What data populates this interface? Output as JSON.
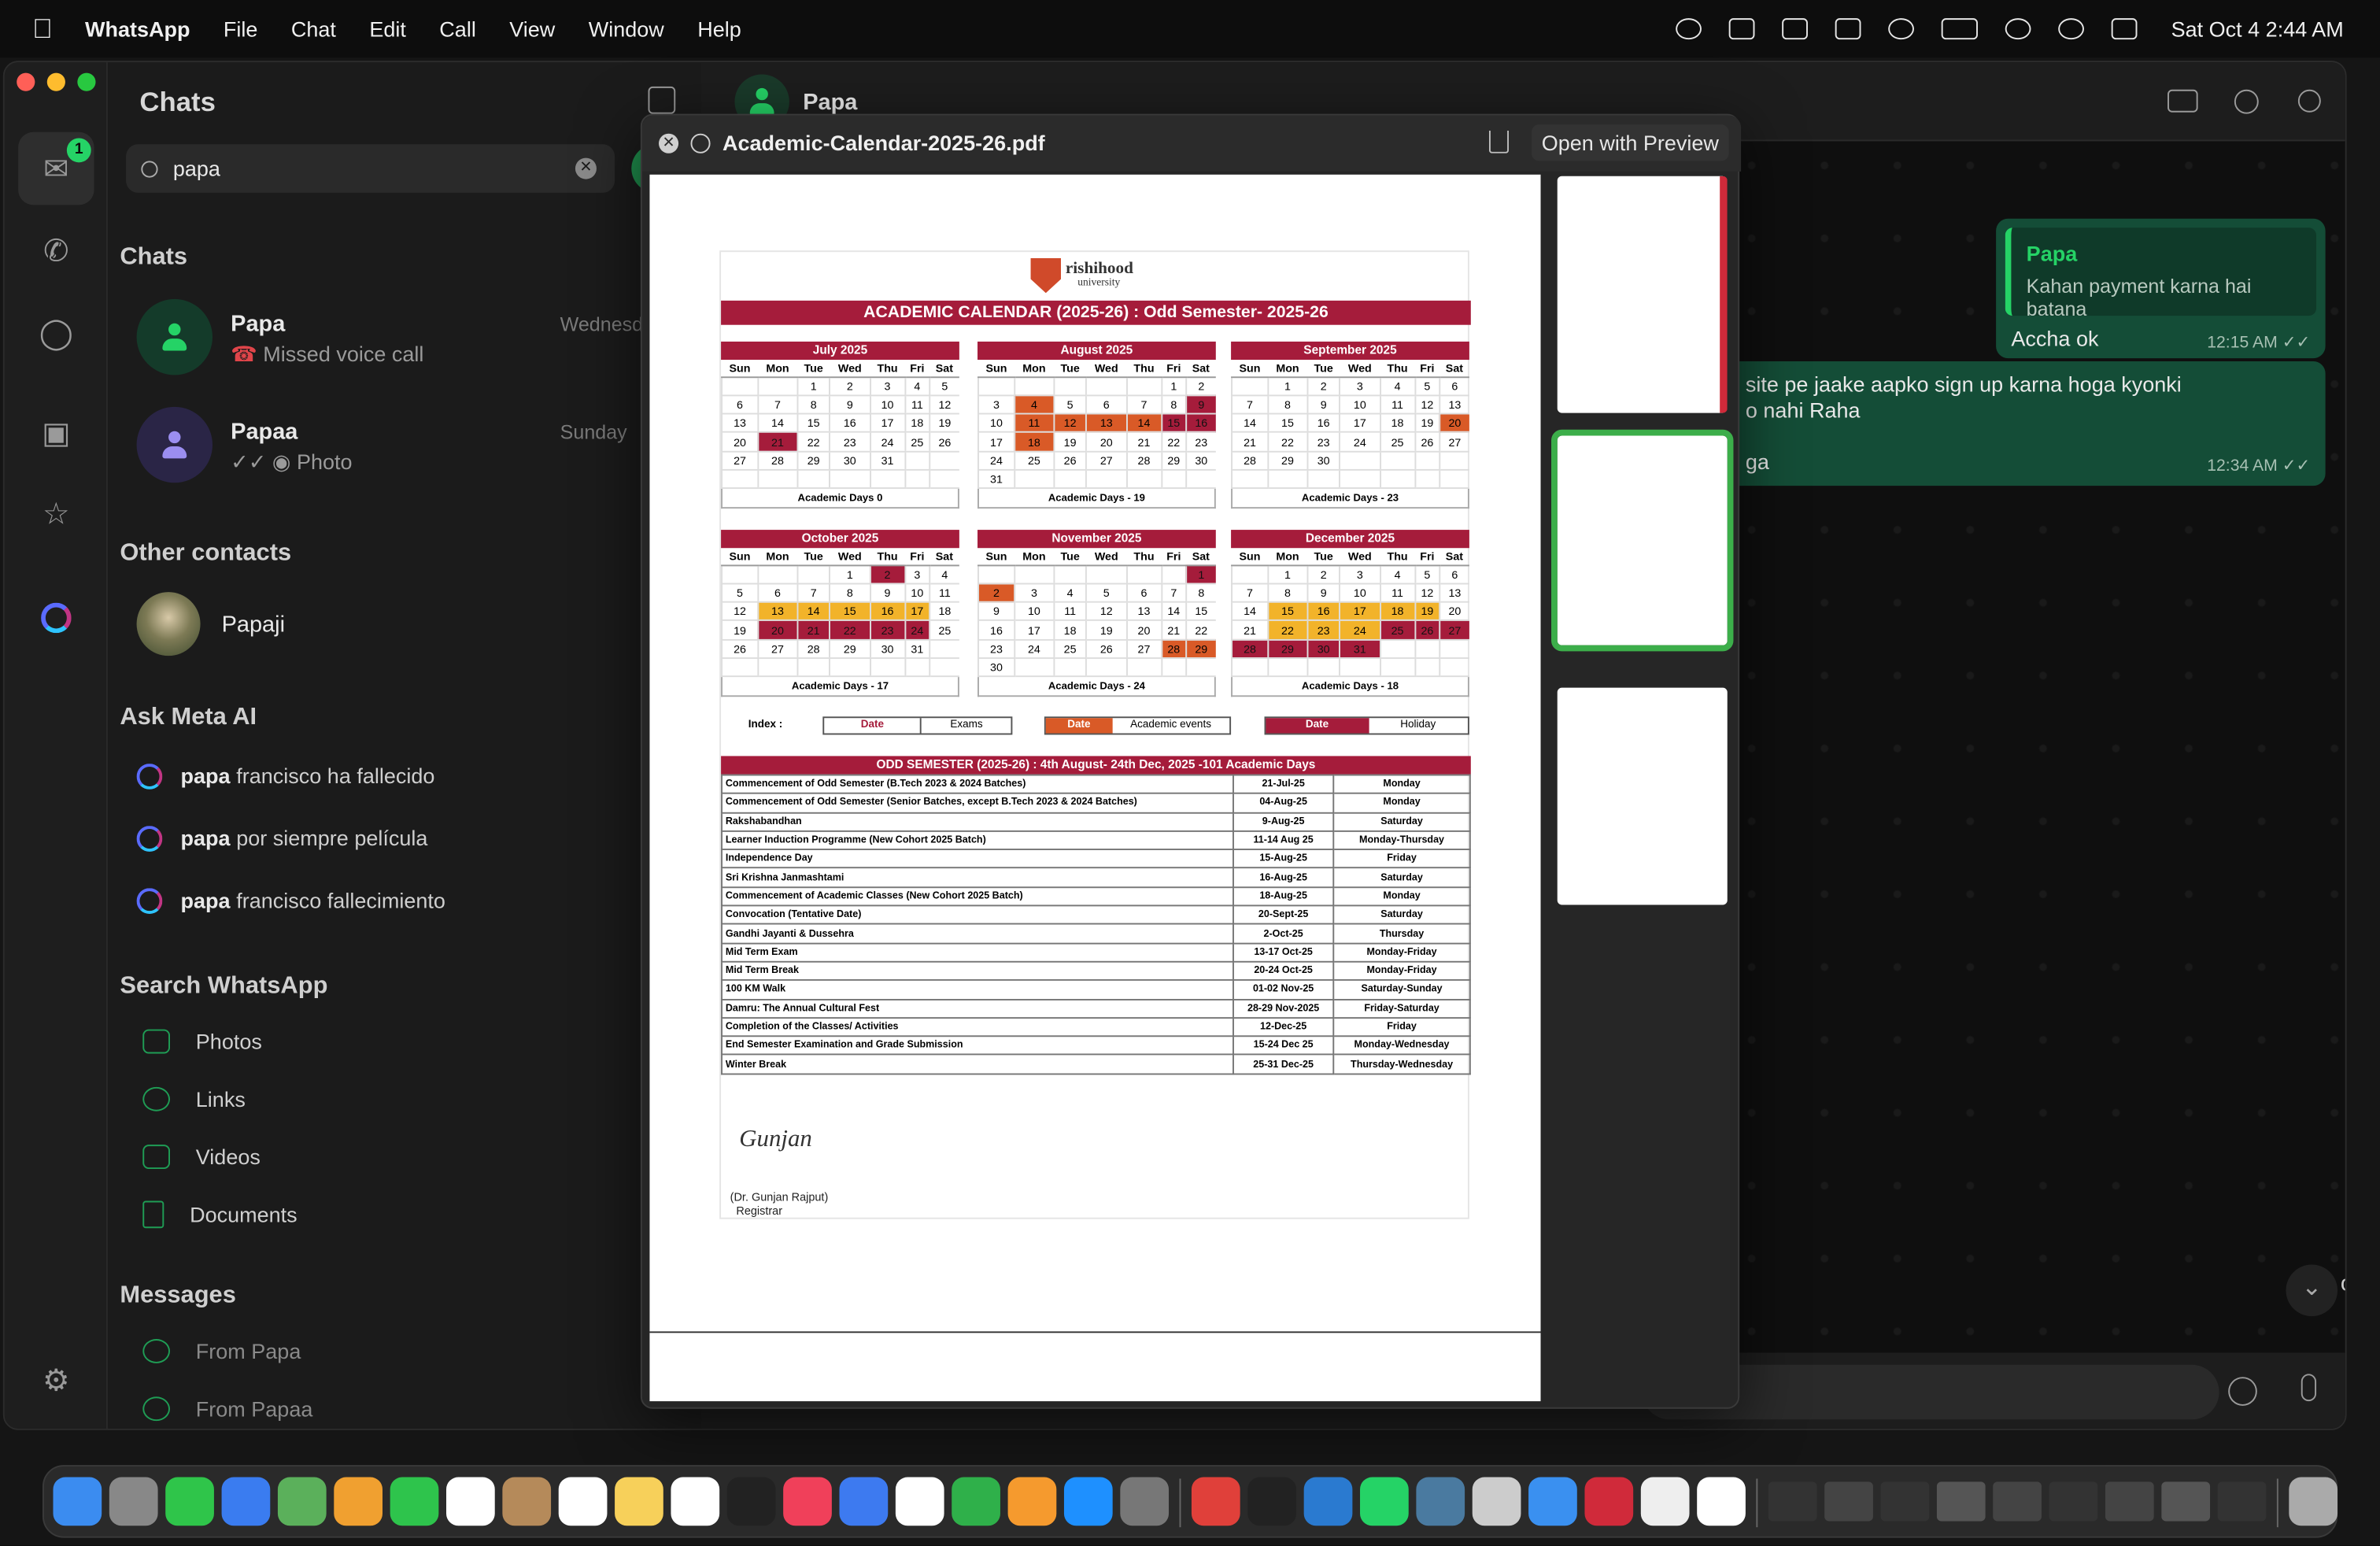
{
  "menubar": {
    "app": "WhatsApp",
    "items": [
      "File",
      "Chat",
      "Edit",
      "Call",
      "View",
      "Window",
      "Help"
    ],
    "clock": "Sat Oct 4  2:44 AM"
  },
  "rail": {
    "badge": "1"
  },
  "sidebar": {
    "title": "Chats",
    "search": {
      "value": "papa"
    },
    "chats_header": "Chats",
    "chats": [
      {
        "name": "Papa",
        "sub": "Missed voice call",
        "time": "Wednesday",
        "sub_icon": "missed-call-icon"
      },
      {
        "name": "Papaa",
        "sub": "Photo",
        "time": "Sunday",
        "sub_icon": "camera-icon"
      }
    ],
    "other_header": "Other contacts",
    "other": [
      {
        "name": "Papaji"
      }
    ],
    "meta_header": "Ask Meta AI",
    "meta": [
      {
        "bold": "papa",
        "rest": "francisco ha fallecido"
      },
      {
        "bold": "papa",
        "rest": "por siempre película"
      },
      {
        "bold": "papa",
        "rest": "francisco fallecimiento"
      }
    ],
    "search_header": "Search WhatsApp",
    "search_items": [
      "Photos",
      "Links",
      "Videos",
      "Documents"
    ],
    "messages_header": "Messages",
    "messages": [
      "From Papa",
      "From Papaa"
    ]
  },
  "conversation": {
    "name": "Papa",
    "bubble1": {
      "quote_name": "Papa",
      "quote_text": "Kahan payment karna hai batana",
      "text": "Accha ok",
      "time": "12:15 AM"
    },
    "bubble2": {
      "line1": "site pe jaake aapko sign up karna hoga kyonki",
      "line2": "o nahi Raha",
      "line3": "ga",
      "time": "12:34 AM"
    },
    "edge_text": "on"
  },
  "quicklook": {
    "title": "Academic-Calendar-2025-26.pdf",
    "open_label": "Open with Preview"
  },
  "document": {
    "logo_line1": "rishihood",
    "logo_line2": "university",
    "banner": "ACADEMIC CALENDAR (2025-26) : Odd Semester- 2025-26",
    "weekdays": [
      "Sun",
      "Mon",
      "Tue",
      "Wed",
      "Thu",
      "Fri",
      "Sat"
    ],
    "months": [
      {
        "name": "July 2025",
        "start": 2,
        "len": 31,
        "days_label": "Academic Days  0",
        "holiday": [
          21
        ],
        "academic": [],
        "exam": []
      },
      {
        "name": "August 2025",
        "start": 5,
        "len": 31,
        "days_label": "Academic Days - 19",
        "holiday": [
          9,
          15,
          16
        ],
        "academic": [
          4,
          11,
          12,
          13,
          14,
          18
        ],
        "exam": []
      },
      {
        "name": "September 2025",
        "start": 1,
        "len": 30,
        "days_label": "Academic Days - 23",
        "holiday": [],
        "academic": [
          20
        ],
        "exam": []
      },
      {
        "name": "October 2025",
        "start": 3,
        "len": 31,
        "days_label": "Academic Days - 17",
        "holiday": [
          2,
          20,
          21,
          22,
          23,
          24
        ],
        "academic": [],
        "exam": [
          13,
          14,
          15,
          16,
          17
        ]
      },
      {
        "name": "November 2025",
        "start": 6,
        "len": 30,
        "days_label": "Academic Days - 24",
        "holiday": [
          1
        ],
        "academic": [
          2,
          28,
          29
        ],
        "exam": []
      },
      {
        "name": "December 2025",
        "start": 1,
        "len": 31,
        "days_label": "Academic Days - 18",
        "holiday": [
          25,
          26,
          27,
          28,
          29,
          30,
          31
        ],
        "academic": [],
        "exam": [
          15,
          16,
          17,
          18,
          19,
          22,
          23,
          24
        ]
      }
    ],
    "index": {
      "label": "Index :",
      "date": "Date",
      "exams": "Exams",
      "academic": "Academic events",
      "holiday": "Holiday"
    },
    "events_title": "ODD SEMESTER (2025-26) : 4th August- 24th Dec, 2025 -101 Academic Days",
    "events": [
      [
        "Commencement of Odd Semester (B.Tech 2023 & 2024 Batches)",
        "21-Jul-25",
        "Monday"
      ],
      [
        "Commencement of Odd Semester (Senior Batches, except B.Tech 2023 & 2024 Batches)",
        "04-Aug-25",
        "Monday"
      ],
      [
        "Rakshabandhan",
        "9-Aug-25",
        "Saturday"
      ],
      [
        "Learner Induction Programme (New Cohort 2025 Batch)",
        "11-14 Aug 25",
        "Monday-Thursday"
      ],
      [
        "Independence Day",
        "15-Aug-25",
        "Friday"
      ],
      [
        "Sri Krishna Janmashtami",
        "16-Aug-25",
        "Saturday"
      ],
      [
        "Commencement of Academic Classes (New Cohort 2025 Batch)",
        "18-Aug-25",
        "Monday"
      ],
      [
        "Convocation (Tentative Date)",
        "20-Sept-25",
        "Saturday"
      ],
      [
        "Gandhi Jayanti & Dussehra",
        "2-Oct-25",
        "Thursday"
      ],
      [
        "Mid Term Exam",
        "13-17 Oct-25",
        "Monday-Friday"
      ],
      [
        "Mid Term Break",
        "20-24 Oct-25",
        "Monday-Friday"
      ],
      [
        "100 KM Walk",
        "01-02 Nov-25",
        "Saturday-Sunday"
      ],
      [
        "Damru: The Annual Cultural Fest",
        "28-29 Nov-2025",
        "Friday-Saturday"
      ],
      [
        "Completion of the Classes/ Activities",
        "12-Dec-25",
        "Friday"
      ],
      [
        "End Semester Examination and Grade Submission",
        "15-24 Dec 25",
        "Monday-Wednesday"
      ],
      [
        "Winter Break",
        "25-31 Dec-25",
        "Thursday-Wednesday"
      ]
    ],
    "signature": "Gunjan",
    "signer": "(Dr. Gunjan Rajput)",
    "signer_title": "Registrar"
  },
  "colors": {
    "accent": "#25d366",
    "calendar_red": "#a51c3b",
    "academic_orange": "#d95a27",
    "exam_yellow": "#f2b32a",
    "bubble": "#144d37"
  }
}
